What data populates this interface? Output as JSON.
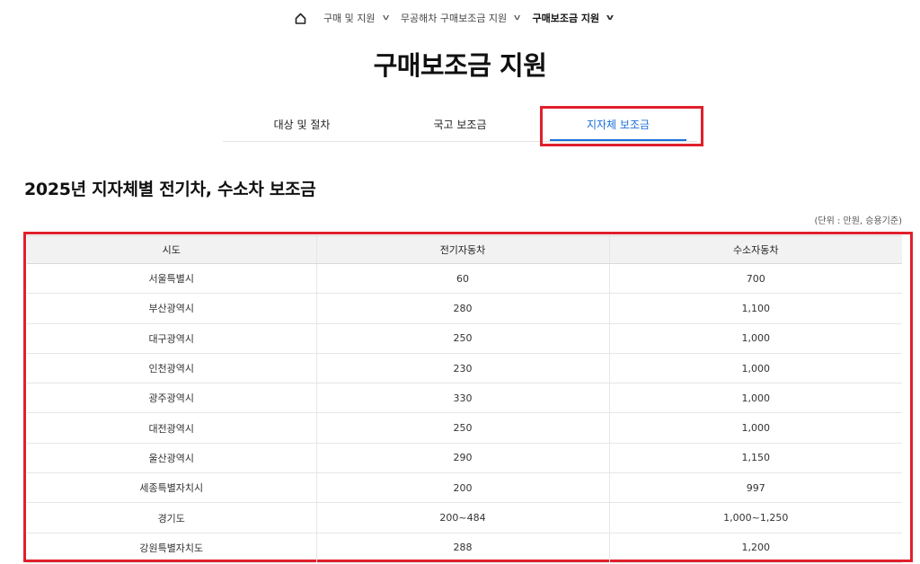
{
  "breadcrumb": {
    "items": [
      {
        "label": "구매 및 지원"
      },
      {
        "label": "무공해차 구매보조금 지원"
      },
      {
        "label": "구매보조금 지원"
      }
    ]
  },
  "page_title": "구매보조금 지원",
  "tabs": [
    {
      "label": "대상 및 절차"
    },
    {
      "label": "국고 보조금"
    },
    {
      "label": "지자체 보조금"
    }
  ],
  "active_tab": "지자체 보조금",
  "section_title": "2025년 지자체별 전기차, 수소차 보조금",
  "unit_note": "(단위 : 만원, 승용기준)",
  "table": {
    "headers": [
      "시도",
      "전기자동차",
      "수소자동차"
    ],
    "rows": [
      [
        "서울특별시",
        "60",
        "700"
      ],
      [
        "부산광역시",
        "280",
        "1,100"
      ],
      [
        "대구광역시",
        "250",
        "1,000"
      ],
      [
        "인천광역시",
        "230",
        "1,000"
      ],
      [
        "광주광역시",
        "330",
        "1,000"
      ],
      [
        "대전광역시",
        "250",
        "1,000"
      ],
      [
        "울산광역시",
        "290",
        "1,150"
      ],
      [
        "세종특별자치시",
        "200",
        "997"
      ],
      [
        "경기도",
        "200~484",
        "1,000~1,250"
      ],
      [
        "강원특별자치도",
        "288",
        "1,200"
      ]
    ]
  },
  "colors": {
    "accent_blue": "#1a6fd8",
    "highlight_red": "#e0202c",
    "header_bg": "#f2f2f2"
  }
}
